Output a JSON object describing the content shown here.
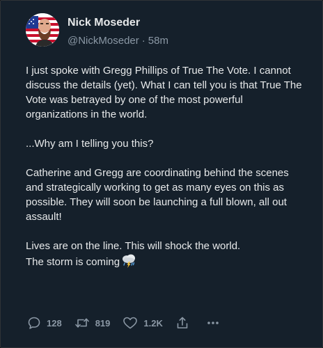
{
  "author": {
    "display_name": "Nick Moseder",
    "handle": "@NickMoseder",
    "separator": "·",
    "timestamp": "58m",
    "avatar_icon": "avatar-photo"
  },
  "tweet": {
    "paragraphs": [
      "I just spoke with Gregg Phillips of True The Vote. I cannot discuss the details (yet). What I can tell you is that True The Vote was betrayed by one of the most powerful organizations in the world.",
      "...Why am I telling you this?",
      "Catherine and Gregg are coordinating behind the scenes and strategically working to get as many eyes on this as possible. They will soon be launching a full blown, all out assault!",
      "Lives are on the line. This will shock the world.\nThe storm is coming"
    ],
    "trailing_emoji": "cloud-with-lightning-and-rain"
  },
  "actions": {
    "reply_count": "128",
    "retweet_count": "819",
    "like_count": "1.2K",
    "share_icon": "share-icon",
    "more_icon": "more-icon"
  },
  "colors": {
    "background": "#15202b",
    "text": "#e7e9ea",
    "secondary_text": "#8b98a5",
    "border": "#2f3336"
  }
}
